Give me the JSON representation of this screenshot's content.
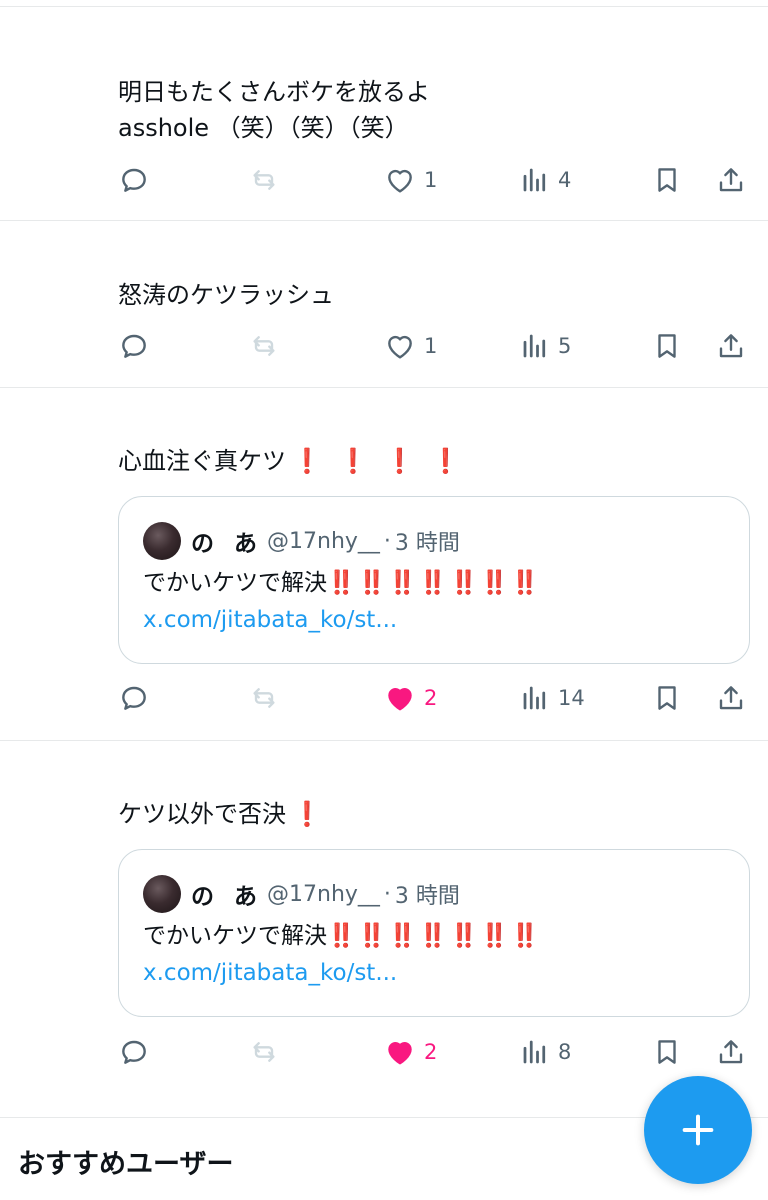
{
  "tweets": [
    {
      "text": "明日もたくさんボケを放るよ\nasshole （笑）（笑）（笑）",
      "excl": "",
      "likes": "1",
      "views": "4",
      "liked": false
    },
    {
      "text": "怒涛のケツラッシュ",
      "excl": "",
      "likes": "1",
      "views": "5",
      "liked": false
    },
    {
      "text": "心血注ぐ真ケツ",
      "excl": "❗ ❗ ❗ ❗",
      "likes": "2",
      "views": "14",
      "liked": true,
      "quote": {
        "name": "の あ",
        "handle": "@17nhy__",
        "sep": "·",
        "time": "3 時間",
        "text": "でかいケツで解決",
        "excl": "‼️‼️‼️‼️‼️‼️‼️",
        "link": "x.com/jitabata_ko/st..."
      }
    },
    {
      "text": "ケツ以外で否決",
      "excl": "❗",
      "likes": "2",
      "views": "8",
      "liked": true,
      "quote": {
        "name": "の あ",
        "handle": "@17nhy__",
        "sep": "·",
        "time": "3 時間",
        "text": "でかいケツで解決",
        "excl": "‼️‼️‼️‼️‼️‼️‼️",
        "link": "x.com/jitabata_ko/st..."
      }
    }
  ],
  "recommended_users_title": "おすすめユーザー",
  "colors": {
    "text": "#0f1419",
    "muted": "#536471",
    "like": "#f91880",
    "link": "#1d9bf0",
    "fab": "#1d9bf0",
    "divider": "#e7e9ea"
  },
  "icons": [
    "reply-icon",
    "retweet-icon",
    "like-icon",
    "views-icon",
    "bookmark-icon",
    "share-icon",
    "plus-icon"
  ]
}
